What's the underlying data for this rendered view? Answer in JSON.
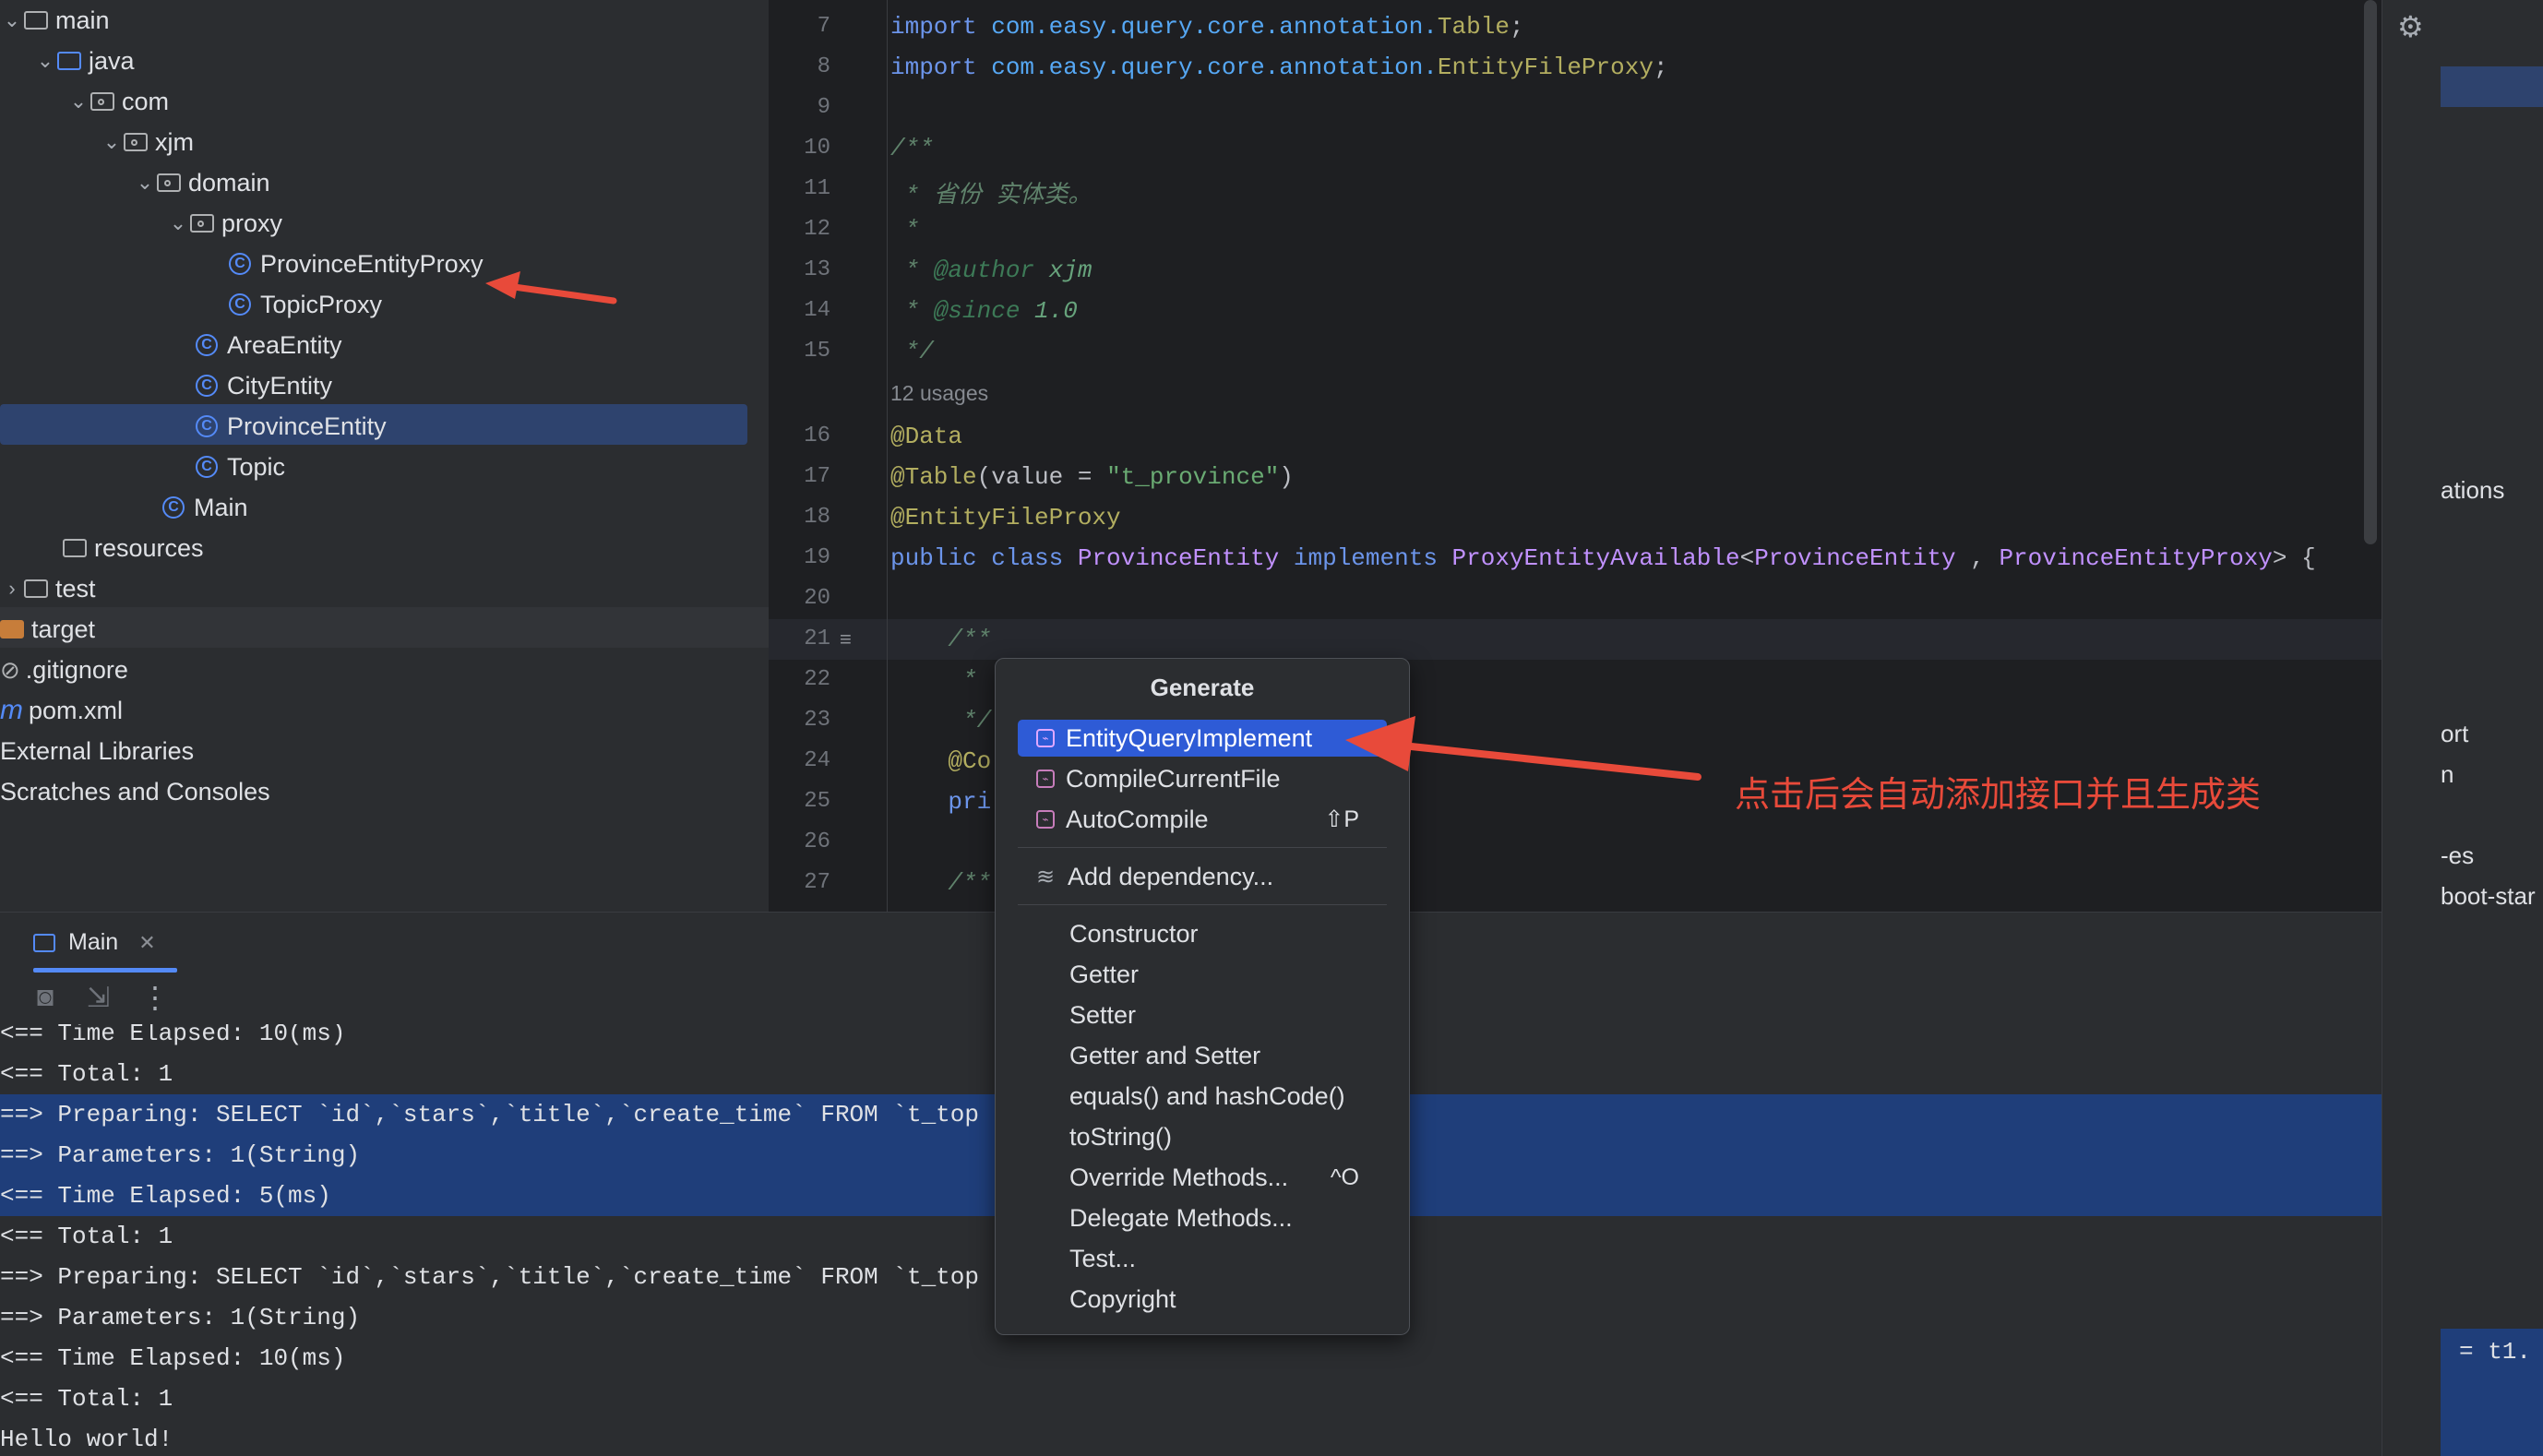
{
  "project_tree": {
    "rows": [
      {
        "label": "main"
      },
      {
        "label": "java"
      },
      {
        "label": "com"
      },
      {
        "label": "xjm"
      },
      {
        "label": "domain"
      },
      {
        "label": "proxy"
      },
      {
        "label": "ProvinceEntityProxy"
      },
      {
        "label": "TopicProxy"
      },
      {
        "label": "AreaEntity"
      },
      {
        "label": "CityEntity"
      },
      {
        "label": "ProvinceEntity"
      },
      {
        "label": "Topic"
      },
      {
        "label": "Main"
      },
      {
        "label": "resources"
      },
      {
        "label": "test"
      },
      {
        "label": "target"
      },
      {
        "label": ".gitignore"
      },
      {
        "label": "pom.xml"
      },
      {
        "label": "External Libraries"
      },
      {
        "label": "Scratches and Consoles"
      }
    ]
  },
  "editor": {
    "line_numbers": [
      "7",
      "8",
      "9",
      "10",
      "11",
      "12",
      "13",
      "14",
      "15",
      "16",
      "17",
      "18",
      "19",
      "20",
      "21",
      "22",
      "23",
      "24",
      "25",
      "26",
      "27"
    ],
    "usages": "12 usages",
    "lines": {
      "l7_kw": "import",
      "l7_pkg": " com.easy.query.core.annotation.",
      "l7_cls": "Table",
      "l7_end": ";",
      "l8_kw": "import",
      "l8_pkg": " com.easy.query.core.annotation.",
      "l8_cls": "EntityFileProxy",
      "l8_end": ";",
      "l10": "/**",
      "l11": " * 省份 实体类。",
      "l12": " *",
      "l13_a": " * ",
      "l13_tag": "@author",
      "l13_v": " xjm",
      "l14_a": " * ",
      "l14_tag": "@since",
      "l14_v": " 1.0",
      "l15": " */",
      "l16": "@Data",
      "l17_a": "@Table",
      "l17_b": "(value = ",
      "l17_s": "\"t_province\"",
      "l17_c": ")",
      "l18": "@EntityFileProxy",
      "l19_a": "public class ",
      "l19_b": "ProvinceEntity ",
      "l19_c": "implements ",
      "l19_d": "ProxyEntityAvailable",
      "l19_e": "<",
      "l19_f": "ProvinceEntity",
      "l19_g": " , ",
      "l19_h": "ProvinceEntityProxy",
      "l19_i": "> {",
      "l21": "    /**",
      "l22": "     *",
      "l23": "     */",
      "l24": "    @Co",
      "l25": "    pri",
      "l27": "    /**"
    }
  },
  "run_panel": {
    "tab_label": "Main",
    "console_lines": [
      "<== Time Elapsed: 10(ms)",
      "<== Total: 1",
      "==> Preparing: SELECT `id`,`stars`,`title`,`create_time` FROM `t_top",
      "==> Parameters: 1(String)",
      "<== Time Elapsed: 5(ms)",
      "<== Total: 1",
      "==> Preparing: SELECT `id`,`stars`,`title`,`create_time` FROM `t_top",
      "==> Parameters: 1(String)",
      "<== Time Elapsed: 10(ms)",
      "<== Total: 1",
      "Hello world!"
    ]
  },
  "generate_popup": {
    "title": "Generate",
    "items": [
      {
        "label": "EntityQueryImplement",
        "shortcut": ""
      },
      {
        "label": "CompileCurrentFile",
        "shortcut": ""
      },
      {
        "label": "AutoCompile",
        "shortcut": "⇧P"
      },
      {
        "label": "Add dependency...",
        "shortcut": ""
      },
      {
        "label": "Constructor",
        "shortcut": ""
      },
      {
        "label": "Getter",
        "shortcut": ""
      },
      {
        "label": "Setter",
        "shortcut": ""
      },
      {
        "label": "Getter and Setter",
        "shortcut": ""
      },
      {
        "label": "equals() and hashCode()",
        "shortcut": ""
      },
      {
        "label": "toString()",
        "shortcut": ""
      },
      {
        "label": "Override Methods...",
        "shortcut": "^O"
      },
      {
        "label": "Delegate Methods...",
        "shortcut": ""
      },
      {
        "label": "Test...",
        "shortcut": ""
      },
      {
        "label": "Copyright",
        "shortcut": ""
      }
    ]
  },
  "right_panel_fragments": [
    "ations",
    "ort",
    "n",
    "-es",
    "boot-star",
    "= t1."
  ],
  "annotation_text": "点击后会自动添加接口并且生成类",
  "colors": {
    "accent": "#2e5bd6",
    "annotation": "#e84a3a",
    "selection": "#2e436e",
    "console_highlight": "#1f3e7a"
  }
}
